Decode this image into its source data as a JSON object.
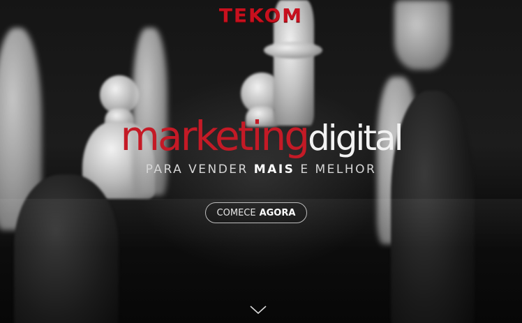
{
  "brand": {
    "logo_text": "TEKOM",
    "accent_color": "#c41a26"
  },
  "hero": {
    "headline_part1": "marketing",
    "headline_part2": "digital",
    "subline_part1": "PARA VENDER ",
    "subline_part2": "MAIS",
    "subline_part3": " E MELHOR",
    "cta_part1": "COMECE",
    "cta_part2": "AGORA"
  },
  "icons": {
    "scroll": "chevron-down-icon"
  }
}
